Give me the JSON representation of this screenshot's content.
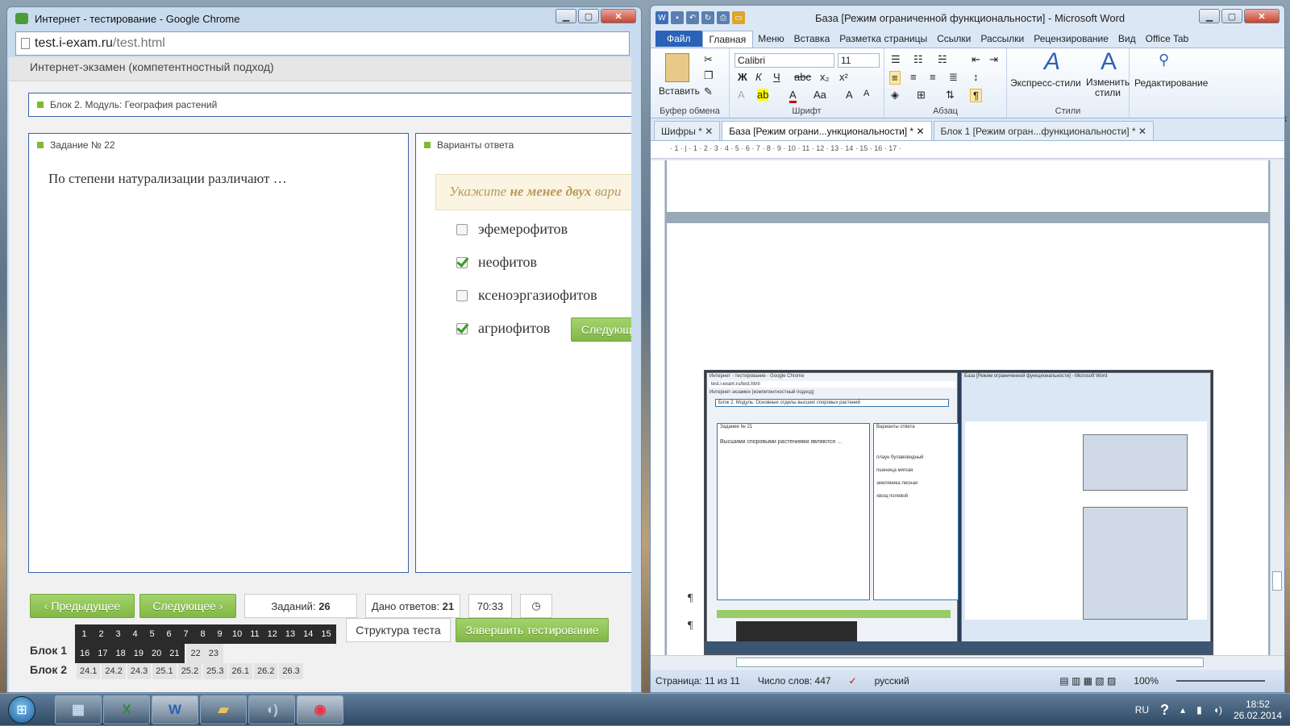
{
  "chrome": {
    "title": "Интернет - тестирование - Google Chrome",
    "url_host": "test.i-exam.ru",
    "url_path": "/test.html",
    "page_header": "Интернет-экзамен (компетентностный подход)",
    "block_title": "Блок 2. Модуль: География растений",
    "task_title": "Задание № 22",
    "question": "По степени натурализации различают …",
    "answers_title": "Варианты ответа",
    "hint_prefix": "Укажите ",
    "hint_bold": "не менее двух",
    "hint_suffix": " вари",
    "options": [
      {
        "label": "эфемерофитов",
        "checked": false
      },
      {
        "label": "неофитов",
        "checked": true
      },
      {
        "label": "ксеноэргазиофитов",
        "checked": false
      },
      {
        "label": "агриофитов",
        "checked": true
      }
    ],
    "next_inline": "Следующ",
    "prev_button": "Предыдущее",
    "next_button": "Следующее",
    "tasks_label": "Заданий:",
    "tasks_count": "26",
    "answered_label": "Дано ответов:",
    "answered_count": "21",
    "timer": "70:33",
    "structure_button": "Структура теста",
    "finish_button": "Завершить тестирование",
    "block1_label": "Блок 1",
    "block2_label": "Блок 2",
    "row1": [
      "1",
      "2",
      "3",
      "4",
      "5",
      "6",
      "7",
      "8",
      "9",
      "10",
      "11",
      "12",
      "13",
      "14",
      "15"
    ],
    "row2_dark": [
      "16",
      "17",
      "18",
      "19",
      "20",
      "21"
    ],
    "row2_light": [
      "22",
      "23"
    ],
    "row3": [
      "24.1",
      "24.2",
      "24.3",
      "25.1",
      "25.2",
      "25.3",
      "26.1",
      "26.2",
      "26.3"
    ]
  },
  "word": {
    "title": "База [Режим ограниченной функциональности] - Microsoft Word",
    "menu": [
      "Файл",
      "Главная",
      "Меню",
      "Вставка",
      "Разметка страницы",
      "Ссылки",
      "Рассылки",
      "Рецензирование",
      "Вид",
      "Office Tab"
    ],
    "paste_label": "Вставить",
    "font_name": "Calibri",
    "font_size": "11",
    "group_clipboard": "Буфер обмена",
    "group_font": "Шрифт",
    "group_paragraph": "Абзац",
    "group_styles": "Стили",
    "express_styles": "Экспресс-стили",
    "change_styles": "Изменить стили",
    "editing": "Редактирование",
    "doc_tabs": [
      "Шифры *",
      "База [Режим ограни...ункциональности] *",
      "Блок 1 [Режим огран...функциональности] *"
    ],
    "ruler_text": "· 1 · | · 1 · 2 · 3 · 4 · 5 · 6 · 7 · 8 · 9 · 10 · 11 · 12 · 13 · 14 · 15 · 16 · 17 ·",
    "pilcrow": "¶",
    "status_page": "Страница: 11 из 11",
    "status_words": "Число слов: 447",
    "status_lang": "русский",
    "zoom": "100%"
  },
  "thumb": {
    "chrome_title": "Интернет - тестирование - Google Chrome",
    "header": "Интернет-экзамен (компетентностный подход)",
    "block": "Блок 2. Модуль: Основные отделы высших споровых растений",
    "task": "Задание № 21",
    "question": "Высшими споровыми растениями являются …",
    "answers_title": "Варианты ответа",
    "options": [
      "плаун булавовидный",
      "пшеница мягкая",
      "земляника лесная",
      "хвощ полевой"
    ],
    "word_title": "База [Режим ограниченной функциональности] - Microsoft Word"
  },
  "taskbar": {
    "lang": "RU",
    "time": "18:52",
    "date": "26.02.2014"
  }
}
